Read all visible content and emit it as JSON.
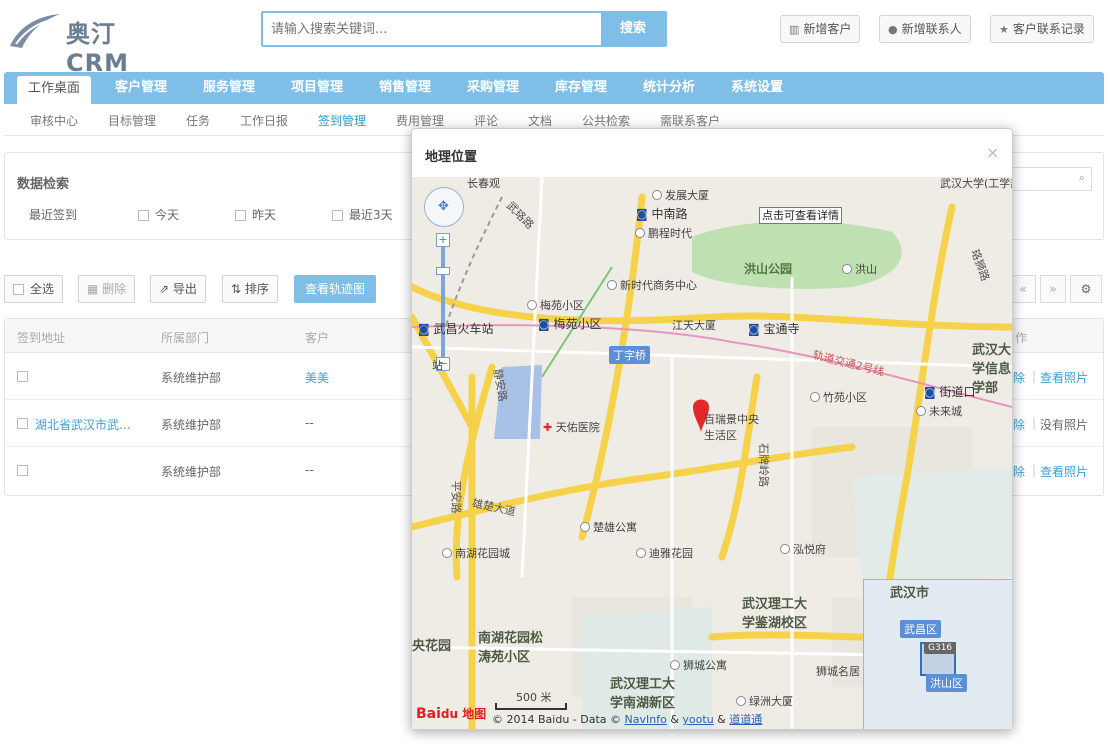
{
  "header": {
    "logo_text": "奥汀CRM",
    "search_placeholder": "请输入搜索关键词...",
    "search_button": "搜索",
    "buttons": [
      {
        "label": "新增客户",
        "icon": "building-icon"
      },
      {
        "label": "新增联系人",
        "icon": "user-icon"
      },
      {
        "label": "客户联系记录",
        "icon": "star-icon"
      }
    ]
  },
  "nav": {
    "items": [
      "工作桌面",
      "客户管理",
      "服务管理",
      "项目管理",
      "销售管理",
      "采购管理",
      "库存管理",
      "统计分析",
      "系统设置"
    ],
    "active": "工作桌面"
  },
  "subnav": {
    "items": [
      "审核中心",
      "目标管理",
      "任务",
      "工作日报",
      "签到管理",
      "费用管理",
      "评论",
      "文档",
      "公共检索",
      "需联系客户"
    ],
    "active": "签到管理"
  },
  "filter": {
    "title": "数据检索",
    "recent_label": "最近签到",
    "options": [
      "今天",
      "昨天",
      "最近3天"
    ]
  },
  "toolbar": {
    "select_all": "全选",
    "delete": "删除",
    "export": "导出",
    "sort": "排序",
    "track": "查看轨迹图",
    "prev": "«",
    "next": "»"
  },
  "table": {
    "headers": [
      "签到地址",
      "所属部门",
      "客户"
    ],
    "action_header": "作",
    "rows": [
      {
        "address": "",
        "dept": "系统维护部",
        "customer": "美美",
        "action1": "除",
        "action2": "查看照片"
      },
      {
        "address": "湖北省武汉市武...",
        "dept": "系统维护部",
        "customer": "--",
        "action1": "除",
        "action2": "没有照片"
      },
      {
        "address": "",
        "dept": "系统维护部",
        "customer": "--",
        "action1": "除",
        "action2": "查看照片"
      }
    ]
  },
  "modal": {
    "title": "地理位置",
    "close": "×",
    "map": {
      "tooltip": "点击可查看详情",
      "marker_label": "百瑞景中央生活区",
      "scale": "500 米",
      "copyright_prefix": "© 2014 Baidu - Data ©",
      "providers": [
        "NavInfo",
        "yootu",
        "道道通"
      ],
      "baidu_logo": "Bai",
      "baidu_logo2": "du 地图",
      "labels": {
        "changchunguan": "长春观",
        "fazhan": "发展大厦",
        "zhongnanlu": "中南路",
        "wuluolu": "武珞路",
        "pengcheng": "鹏程时代",
        "hongshanpark": "洪山公园",
        "hongshan": "洪山",
        "xinshidai": "新时代商务中心",
        "meiyuan1": "梅苑小区",
        "meiyuan2": "梅苑小区",
        "wuchang": "武昌火车站",
        "jiangtian": "江天大厦",
        "baotong": "宝通寺",
        "dingziqiao": "丁字桥",
        "metro": "轨道交通2号线",
        "jingan": "静安路",
        "tianyou": "天佑医院",
        "zhuyuan": "竹苑小区",
        "jiedaokou": "街道口",
        "weilaicheng": "未来城",
        "xinxi": "武汉大学信息学部",
        "shipailing": "石牌岭路",
        "xiongchu": "雄楚大道",
        "chuxiong": "楚雄公寓",
        "nanhu": "南湖花园城",
        "diya": "迪雅花园",
        "hongyue": "泓悦府",
        "pingan": "平安路",
        "ligong1": "武汉理工大学鉴湖校区",
        "nanhusong": "南湖花园松涛苑小区",
        "shicheng": "狮城公寓",
        "lvzhou": "绿洲大厦",
        "ligong2": "武汉理工大学南湖新区",
        "shicheng2": "狮城名居",
        "huayuan": "央花园",
        "wuhan_u": "武汉大学(工学部)",
        "huanlu": "珞狮路",
        "zhan": "站"
      },
      "inset": {
        "city": "武汉市",
        "wuchang": "武昌区",
        "hongshan": "洪山区",
        "g316": "G316"
      }
    }
  }
}
